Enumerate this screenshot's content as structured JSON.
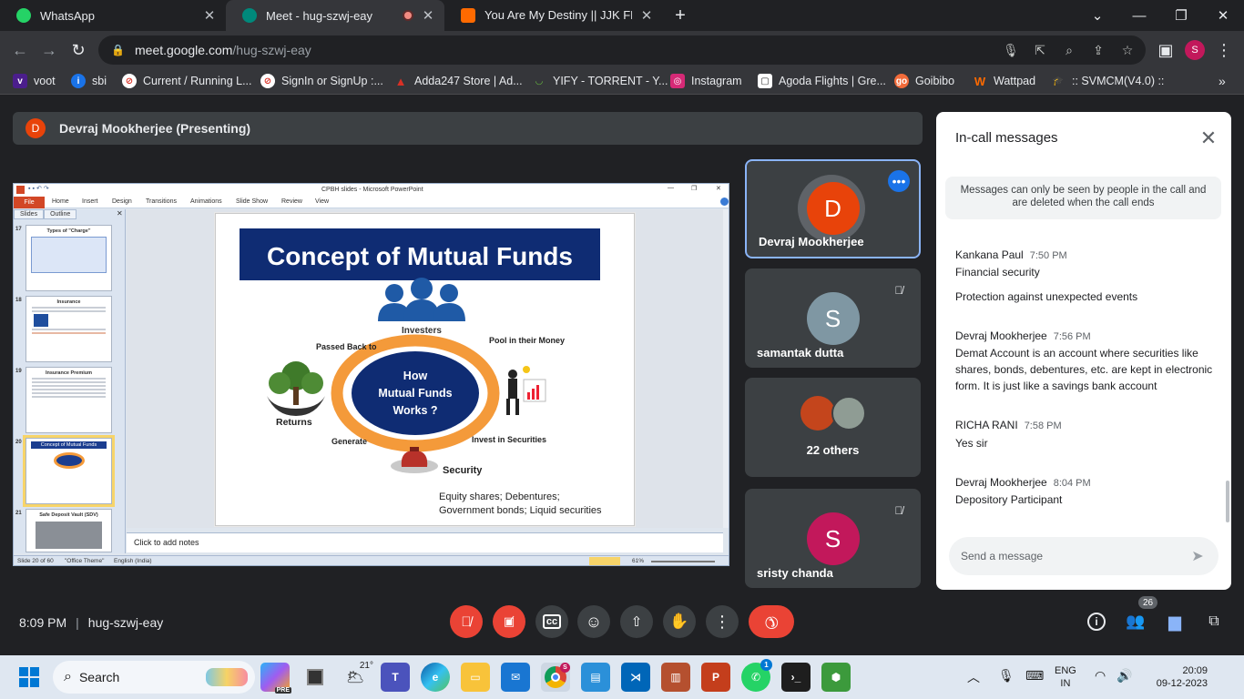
{
  "browser": {
    "tabs": [
      {
        "title": "WhatsApp",
        "color": "#25d366"
      },
      {
        "title": "Meet - hug-szwj-eay",
        "color": "#00897b",
        "recording": true
      },
      {
        "title": "You Are My Destiny || JJK FF || ✓",
        "color": "#ff6a00"
      }
    ],
    "new_tab": "+",
    "url_host": "meet.google.com",
    "url_path": "/hug-szwj-eay",
    "profile_initial": "S",
    "bookmarks": [
      {
        "label": "voot",
        "icon": "voot"
      },
      {
        "label": "sbi",
        "icon": "sbi"
      },
      {
        "label": "Current / Running L...",
        "icon": "cancel"
      },
      {
        "label": "SignIn or SignUp :...",
        "icon": "cancel"
      },
      {
        "label": "Adda247 Store | Ad...",
        "icon": "adda"
      },
      {
        "label": "YIFY - TORRENT - Y...",
        "icon": "yify"
      },
      {
        "label": "Instagram",
        "icon": "instagram"
      },
      {
        "label": "Agoda Flights | Gre...",
        "icon": "agoda"
      },
      {
        "label": "Goibibo",
        "icon": "goibibo"
      },
      {
        "label": "Wattpad",
        "icon": "wattpad"
      },
      {
        "label": ":: SVMCM(V4.0) ::",
        "icon": "cap"
      }
    ]
  },
  "meet": {
    "presenter_initial": "D",
    "presenter_label": "Devraj Mookherjee (Presenting)",
    "ppt": {
      "title": "CPBH slides - Microsoft PowerPoint",
      "menu": [
        "File",
        "Home",
        "Insert",
        "Design",
        "Transitions",
        "Animations",
        "Slide Show",
        "Review",
        "View"
      ],
      "panel_tabs": [
        "Slides",
        "Outline"
      ],
      "thumbs": [
        {
          "num": "17",
          "title": "Types of \"Charge\""
        },
        {
          "num": "18",
          "title": "Insurance"
        },
        {
          "num": "19",
          "title": "Insurance Premium"
        },
        {
          "num": "20",
          "title": "Concept of Mutual Funds"
        },
        {
          "num": "21",
          "title": "Safe Deposit Vault (SDV)"
        }
      ],
      "notes_placeholder": "Click to add notes",
      "status_slide": "Slide 20 of 60",
      "status_theme": "\"Office Theme\"",
      "status_lang": "English (India)",
      "status_zoom": "61%"
    },
    "slide": {
      "title": "Concept of Mutual Funds",
      "investers": "Investers",
      "pool": "Pool in their Money",
      "passed_back": "Passed Back to",
      "returns": "Returns",
      "center": "How Mutual Funds Works ?",
      "generate": "Generate",
      "invest": "Invest in Securities",
      "security": "Security",
      "securities_line1": "Equity shares; Debentures;",
      "securities_line2": "Government bonds; Liquid securities"
    },
    "participants": [
      {
        "name": "Devraj Mookherjee",
        "initial": "D",
        "color": "#e8430a"
      },
      {
        "name": "samantak dutta",
        "initial": "S",
        "color": "#7f97a3"
      },
      {
        "name": "22 others"
      },
      {
        "name": "sristy chanda",
        "initial": "S",
        "color": "#c2185b"
      }
    ],
    "chat": {
      "title": "In-call messages",
      "note": "Messages can only be seen by people in the call and are deleted when the call ends",
      "messages": [
        {
          "sender": "Kankana Paul",
          "time": "7:50 PM",
          "lines": [
            "Financial security",
            "Protection against unexpected events"
          ]
        },
        {
          "sender": "Devraj Mookherjee",
          "time": "7:56 PM",
          "lines": [
            "Demat Account is an account where securities like shares, bonds, debentures, etc. are kept in electronic form. It is just like a savings bank account"
          ]
        },
        {
          "sender": "RICHA RANI",
          "time": "7:58 PM",
          "lines": [
            "Yes sir"
          ]
        },
        {
          "sender": "Devraj Mookherjee",
          "time": "8:04 PM",
          "lines": [
            "Depository Participant"
          ]
        }
      ],
      "placeholder": "Send a message"
    },
    "time": "8:09 PM",
    "meeting_code": "hug-szwj-eay",
    "people_count": "26"
  },
  "taskbar": {
    "search": "Search",
    "weather": "21°",
    "lang": "ENG",
    "region": "IN",
    "time": "20:09",
    "date": "09-12-2023",
    "chrome_badge": "S",
    "whatsapp_badge": "1",
    "copilot_badge": "PRE"
  }
}
